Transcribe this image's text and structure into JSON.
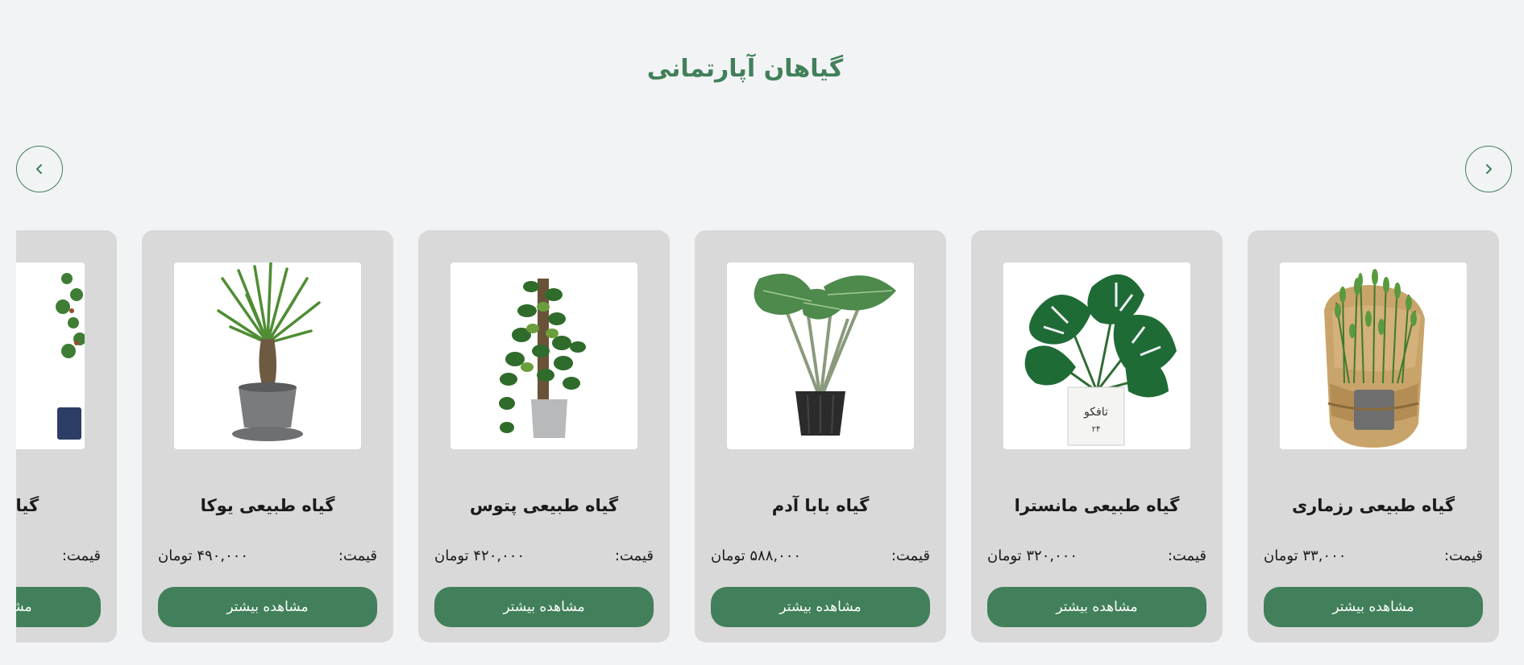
{
  "section": {
    "title": "گیاهان آپارتمانی"
  },
  "nav": {
    "prev_icon": "chevron-left-icon",
    "next_icon": "chevron-right-icon"
  },
  "colors": {
    "accent": "#41805a",
    "card_bg": "#d9d9d9",
    "page_bg": "#f2f3f5"
  },
  "products": [
    {
      "name": "گیاه طبیعی رزماری",
      "price_label": "قیمت:",
      "price": "۳۳,۰۰۰ تومان",
      "button_label": "مشاهده بیشتر",
      "image": "rosemary-plant-image"
    },
    {
      "name": "گیاه طبیعی مانسترا",
      "price_label": "قیمت:",
      "price": "۳۲۰,۰۰۰ تومان",
      "button_label": "مشاهده بیشتر",
      "image": "monstera-plant-image",
      "pot_text": "تافکو"
    },
    {
      "name": "گیاه بابا آدم",
      "price_label": "قیمت:",
      "price": "۵۸۸,۰۰۰ تومان",
      "button_label": "مشاهده بیشتر",
      "image": "alocasia-plant-image"
    },
    {
      "name": "گیاه طبیعی پتوس",
      "price_label": "قیمت:",
      "price": "۴۲۰,۰۰۰ تومان",
      "button_label": "مشاهده بیشتر",
      "image": "pothos-plant-image"
    },
    {
      "name": "گیاه طبیعی یوکا",
      "price_label": "قیمت:",
      "price": "۴۹۰,۰۰۰ تومان",
      "button_label": "مشاهده بیشتر",
      "image": "yucca-plant-image"
    },
    {
      "name": "گیاه طبیعی",
      "price_label": "قیمت:",
      "price": "",
      "button_label": "مشاهده بیشتر",
      "image": "bonsai-plant-image"
    }
  ]
}
